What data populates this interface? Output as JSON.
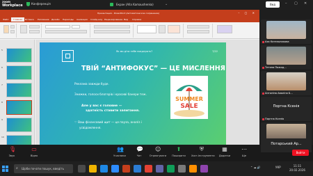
{
  "zoom_top": {
    "logo_line1": "zoom",
    "logo_line2": "Workplace",
    "conference_label": "Конференція",
    "screen_share_label": "Екран (Alla Kamaushenko)",
    "view_button": "Вид"
  },
  "ppt": {
    "title_text": "Презентация - PowerPoint (Автоматическое сохранение)",
    "tabs": [
      "Файл",
      "Главная",
      "Вставка",
      "Рисование",
      "Дизайн",
      "Переходы",
      "Анимация",
      "Слайд-шоу",
      "Рецензирование",
      "Вид",
      "Справка"
    ],
    "thumb_numbers": [
      "5",
      "6",
      "7",
      "8",
      "9",
      "10"
    ],
    "status_left": "Слайд 7 из 24",
    "notes_label": "Заметки к слайду"
  },
  "slide": {
    "top_text": "Як ми діти тебе поєднують?",
    "page_no": "7/22",
    "title": "ТВІЙ “АНТИФОКУС” — ЦЕ МИСЛЕННЯ",
    "line1": "Реклама завжди буде.",
    "line2": "Знижки, голоси блогерів і красиві банери теж.",
    "bold1": "Але у вас є головне —",
    "bold2": "здатність ставити запитання.",
    "line3": "♡ Ваш фінансовий щит — це пауза, аналіз і",
    "line4": "усвідомлення.",
    "image_text1": "SUMMER",
    "image_text2": "SALE"
  },
  "participants": [
    {
      "name": "Аза Кательникова",
      "cam": "face"
    },
    {
      "name": "Тетяна Пожид...",
      "cam": "face"
    },
    {
      "name": "Антоніна Аваліна Б...",
      "cam": "face"
    },
    {
      "name": "Портна Ксенія",
      "sub": "Портна Ксенія",
      "cam": "none"
    },
    {
      "name": "Vadim Bayernov",
      "cam": "face"
    },
    {
      "name": "Потарський Ар...",
      "sub": "Потарський Артем",
      "cam": "none"
    }
  ],
  "zoom_bar": {
    "buttons": [
      {
        "label": "Звук",
        "icon": "mic-icon"
      },
      {
        "label": "Відео",
        "icon": "video-icon"
      },
      {
        "label": "Учасники",
        "icon": "participants-icon",
        "count": "16"
      },
      {
        "label": "Чат",
        "icon": "chat-icon"
      },
      {
        "label": "Отреагувати",
        "icon": "react-icon"
      },
      {
        "label": "Поширити",
        "icon": "share-icon"
      },
      {
        "label": "Хост-інструменти",
        "icon": "host-tools-icon"
      },
      {
        "label": "Додатки",
        "icon": "apps-icon"
      },
      {
        "label": "Ще",
        "icon": "more-icon"
      }
    ],
    "end_label": "Вийти"
  },
  "taskbar": {
    "search_placeholder": "Щоби почати пошук, введіть",
    "time": "11:11",
    "date": "20.02.2026",
    "lang": "УКР"
  },
  "colors": {
    "ppt_accent": "#c43e1c",
    "zoom_green": "#2dba5b",
    "end_red": "#e11122"
  }
}
